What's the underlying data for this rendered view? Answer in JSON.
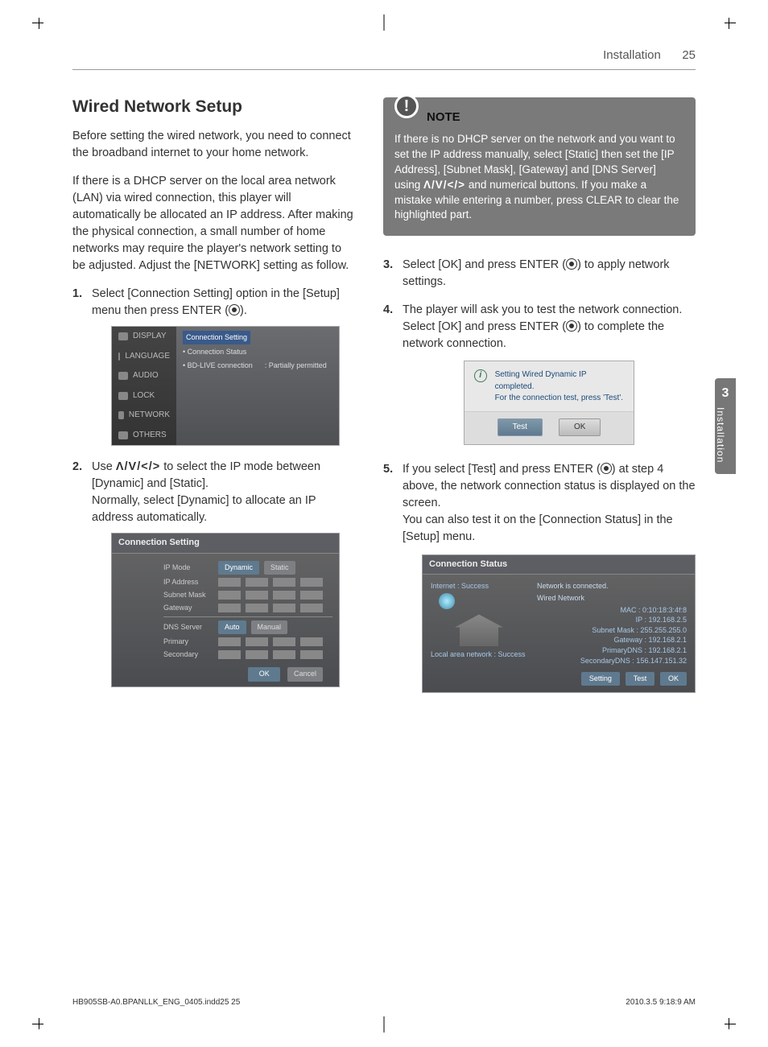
{
  "header": {
    "section": "Installation",
    "page": "25"
  },
  "sidetab": {
    "num": "3",
    "label": "Installation"
  },
  "title": "Wired Network Setup",
  "intro1": "Before setting the wired network, you need to connect the broadband internet to your home network.",
  "intro2": "If there is a DHCP server on the local area network (LAN) via wired connection, this player will automatically be allocated an IP address. After making the physical connection, a small number of home networks may require the player's network setting to be adjusted. Adjust the [NETWORK] setting as follow.",
  "steps": {
    "s1a": "Select [Connection Setting] option in the [Setup] menu then press ENTER (",
    "s1b": ").",
    "s2a": "Use ",
    "s2dir": "Λ/V/</>",
    "s2b": " to select the IP mode between [Dynamic] and [Static].",
    "s2c": "Normally, select [Dynamic] to allocate an IP address automatically.",
    "s3a": "Select [OK] and press ENTER (",
    "s3b": ") to apply network settings.",
    "s4a": "The player will ask you to test the network connection. Select [OK] and press ENTER (",
    "s4b": ") to complete the network connection.",
    "s5a": "If you select [Test] and press ENTER (",
    "s5b": ") at step 4 above, the network connection status is displayed on the screen.",
    "s5c": "You can also test it on the [Connection Status] in the [Setup] menu."
  },
  "note": {
    "title": "NOTE",
    "body_a": "If there is no DHCP server on the network and you want to set the IP address manually, select [Static] then set the [IP Address], [Subnet Mask], [Gateway] and [DNS Server] using ",
    "body_dir": "Λ/V/</>",
    "body_b": " and numerical buttons. If you make a mistake while entering a number, press CLEAR to clear the highlighted part."
  },
  "setup_shot": {
    "menu": [
      "DISPLAY",
      "LANGUAGE",
      "AUDIO",
      "LOCK",
      "NETWORK",
      "OTHERS"
    ],
    "sel": "Connection Setting",
    "line1": "Connection Status",
    "line2a": "BD-LIVE connection",
    "line2b": ": Partially permitted"
  },
  "conn_shot": {
    "title": "Connection Setting",
    "ipmode": "IP Mode",
    "dynamic": "Dynamic",
    "static": "Static",
    "ipaddr": "IP Address",
    "subnet": "Subnet Mask",
    "gateway": "Gateway",
    "dns": "DNS Server",
    "auto": "Auto",
    "manual": "Manual",
    "primary": "Primary",
    "secondary": "Secondary",
    "ok": "OK",
    "cancel": "Cancel"
  },
  "test_shot": {
    "line1": "Setting Wired Dynamic IP completed.",
    "line2": "For the connection test, press 'Test'.",
    "test": "Test",
    "ok": "OK"
  },
  "status_shot": {
    "title": "Connection Status",
    "internet": "Internet : Success",
    "lan": "Local area network : Success",
    "connected": "Network is connected.",
    "wired": "Wired Network",
    "mac": "MAC : 0:10:18:3:4f:8",
    "ip": "IP : 192.168.2.5",
    "mask": "Subnet Mask : 255.255.255.0",
    "gw": "Gateway : 192.168.2.1",
    "pdns": "PrimaryDNS : 192.168.2.1",
    "sdns": "SecondaryDNS : 156.147.151.32",
    "setting": "Setting",
    "test": "Test",
    "ok": "OK"
  },
  "footer": {
    "left": "HB905SB-A0.BPANLLK_ENG_0405.indd25   25",
    "right": "2010.3.5   9:18:9 AM"
  }
}
